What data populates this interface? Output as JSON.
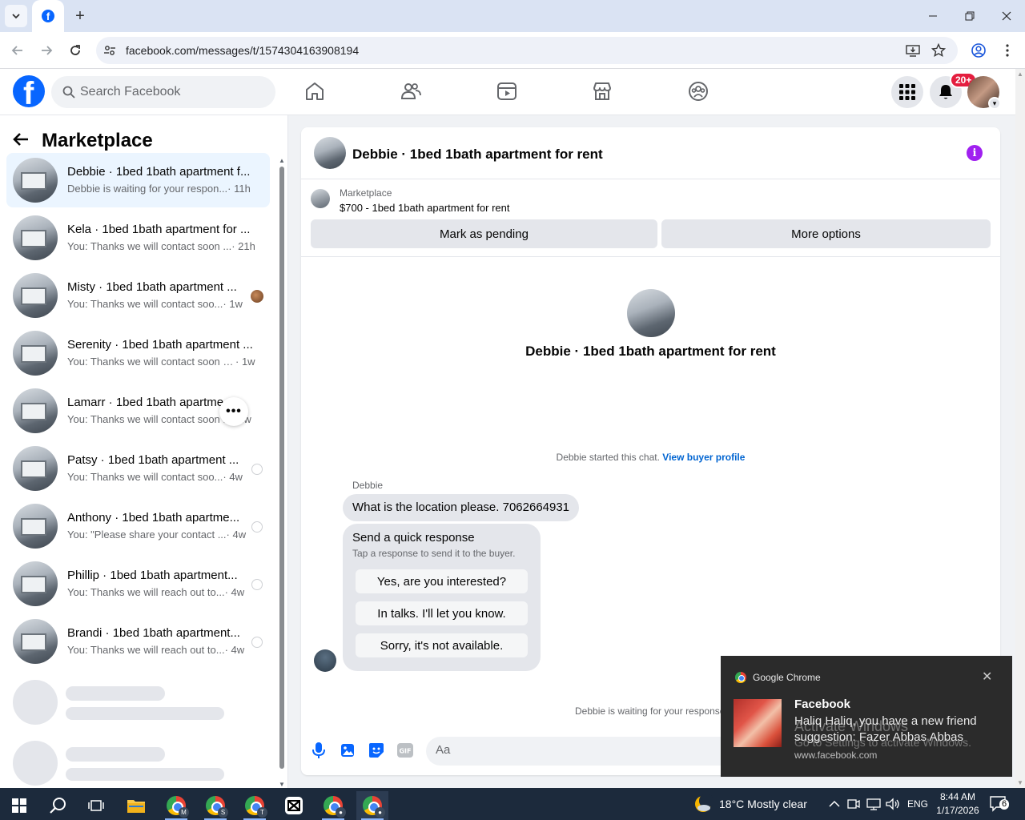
{
  "browser": {
    "url": "facebook.com/messages/t/1574304163908194"
  },
  "header": {
    "search_placeholder": "Search Facebook",
    "notifications_badge": "20+"
  },
  "sidebar": {
    "title": "Marketplace",
    "conversations": [
      {
        "title": "Debbie · 1bed 1bath apartment f...",
        "preview": "Debbie is waiting for your respon...",
        "time": " · 11h",
        "active": true,
        "status": "none"
      },
      {
        "title": "Kela · 1bed 1bath apartment for ...",
        "preview": "You: Thanks we will contact soon ...",
        "time": " · 21h",
        "active": false,
        "status": "none"
      },
      {
        "title": "Misty · 1bed 1bath apartment ...",
        "preview": "You: Thanks we will contact soo...",
        "time": " · 1w",
        "active": false,
        "status": "seen"
      },
      {
        "title": "Serenity · 1bed 1bath apartment ...",
        "preview": "You: Thanks we will contact soon w...",
        "time": " · 1w",
        "active": false,
        "status": "none"
      },
      {
        "title": "Lamarr · 1bed 1bath apartme...",
        "preview": "You: Thanks we will contact soon ...",
        "time": " · 1w",
        "active": false,
        "status": "none"
      },
      {
        "title": "Patsy · 1bed 1bath apartment ...",
        "preview": "You: Thanks we will contact soo...",
        "time": " · 4w",
        "active": false,
        "status": "sent"
      },
      {
        "title": "Anthony · 1bed 1bath apartme...",
        "preview": "You: \"Please share your contact ...",
        "time": " · 4w",
        "active": false,
        "status": "sent"
      },
      {
        "title": "Phillip · 1bed 1bath apartment...",
        "preview": "You: Thanks we will reach out to...",
        "time": " · 4w",
        "active": false,
        "status": "sent"
      },
      {
        "title": "Brandi · 1bed 1bath apartment...",
        "preview": "You: Thanks we will reach out to...",
        "time": " · 4w",
        "active": false,
        "status": "sent"
      }
    ]
  },
  "chat": {
    "title": "Debbie · 1bed 1bath apartment for rent",
    "listing_category": "Marketplace",
    "listing_price_title": "$700 - 1bed 1bath apartment for rent",
    "mark_pending_label": "Mark as pending",
    "more_options_label": "More options",
    "intro_name": "Debbie · 1bed 1bath apartment for rent",
    "started_text": "Debbie started this chat.",
    "view_profile_link": "View buyer profile",
    "sender_name": "Debbie",
    "message": "What is the location please. 7062664931",
    "quick_response_title": "Send a quick response",
    "quick_response_subtitle": "Tap a response to send it to the buyer.",
    "quick_responses": [
      "Yes, are you interested?",
      "In talks. I'll let you know.",
      "Sorry, it's not available."
    ],
    "waiting_text": "Debbie is waiting for your response",
    "composer_placeholder": "Aa"
  },
  "notification": {
    "app": "Google Chrome",
    "title": "Facebook",
    "body": "Haliq Haliq, you have a new friend suggestion: Fazer Abbas Abbas",
    "source": "www.facebook.com",
    "watermark_1": "Activate Windows",
    "watermark_2": "Go to Settings to activate Windows."
  },
  "taskbar": {
    "weather": "18°C  Mostly clear",
    "language": "ENG",
    "time": "8:44 AM",
    "date": "1/17/2026",
    "notification_count": "6",
    "chrome_profiles": [
      "M",
      "S",
      "T",
      "",
      ""
    ]
  },
  "colors": {
    "fb_blue": "#0866ff",
    "active_conv": "#ebf5ff",
    "link": "#0064d1",
    "info": "#a020f0"
  }
}
